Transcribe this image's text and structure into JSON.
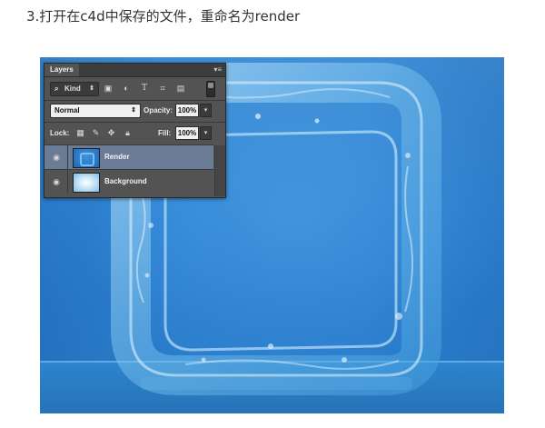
{
  "caption": "3.打开在c4d中保存的文件，重命名为render",
  "panel": {
    "tab_label": "Layers",
    "menu_glyph": "▾≡",
    "filter": {
      "kind_label": "Kind",
      "icons": [
        "search-icon",
        "image-filter-icon",
        "adjustment-filter-icon",
        "type-filter-icon",
        "shape-filter-icon",
        "smart-object-filter-icon"
      ]
    },
    "blend_mode": "Normal",
    "opacity_label": "Opacity:",
    "opacity_value": "100%",
    "lock_label": "Lock:",
    "lock_icons": [
      "lock-transparent-icon",
      "lock-paint-icon",
      "lock-position-icon",
      "lock-all-icon"
    ],
    "fill_label": "Fill:",
    "fill_value": "100%",
    "layers": [
      {
        "name": "Render",
        "visible": true,
        "selected": true
      },
      {
        "name": "Background",
        "visible": true,
        "selected": false
      }
    ]
  },
  "colors": {
    "canvas_blue": "#2f86d6",
    "panel_bg": "#535353",
    "selected_layer": "#6a7b95"
  }
}
